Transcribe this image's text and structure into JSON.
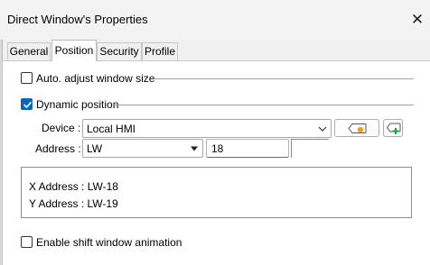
{
  "window": {
    "title": "Direct Window's Properties",
    "close_glyph": "✕"
  },
  "tabs": [
    {
      "label": "General",
      "active": false
    },
    {
      "label": "Position",
      "active": true
    },
    {
      "label": "Security",
      "active": false
    },
    {
      "label": "Profile",
      "active": false
    }
  ],
  "position": {
    "auto_adjust": {
      "label": "Auto. adjust window size",
      "checked": false
    },
    "dynamic_position": {
      "label": "Dynamic position",
      "checked": true
    },
    "device": {
      "label": "Device :",
      "value": "Local HMI"
    },
    "address": {
      "label": "Address :",
      "type_value": "LW",
      "number_value": "18"
    },
    "info": {
      "x_address": "X Address : LW-18",
      "y_address": "Y Address : LW-19"
    },
    "shift_animation": {
      "label": "Enable shift window animation",
      "checked": false
    }
  },
  "icons": {
    "tag_button": "tag-icon",
    "tag_add_button": "tag-add-icon",
    "accent_color": "#0067c0",
    "tag_dot_color": "#f0a020",
    "add_color": "#1f9e3a"
  }
}
